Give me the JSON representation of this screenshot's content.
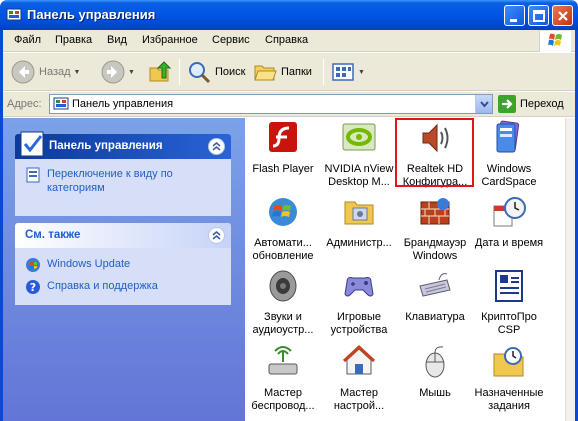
{
  "window": {
    "title": "Панель управления"
  },
  "menu": [
    "Файл",
    "Правка",
    "Вид",
    "Избранное",
    "Сервис",
    "Справка"
  ],
  "toolbar": {
    "back": "Назад",
    "search": "Поиск",
    "folders": "Папки"
  },
  "address": {
    "label": "Адрес:",
    "value": "Панель управления",
    "go": "Переход"
  },
  "left": {
    "panel1": {
      "title": "Панель управления",
      "link": [
        "Переключение к виду по",
        "категориям"
      ]
    },
    "panel2": {
      "title": "См. также",
      "links": [
        "Windows Update",
        "Справка и поддержка"
      ]
    }
  },
  "items": [
    {
      "l1": "Flash Player",
      "l2": "",
      "icon": "flash-player-icon"
    },
    {
      "l1": "NVIDIA nView",
      "l2": "Desktop M...",
      "icon": "nvidia-icon"
    },
    {
      "l1": "Realtek HD",
      "l2": "Конфигура...",
      "icon": "speaker-icon"
    },
    {
      "l1": "Windows",
      "l2": "CardSpace",
      "icon": "cardspace-icon"
    },
    {
      "l1": "Автомати...",
      "l2": "обновление",
      "icon": "windows-update-icon"
    },
    {
      "l1": "Администр...",
      "l2": "",
      "icon": "admin-tools-icon"
    },
    {
      "l1": "Брандмауэр",
      "l2": "Windows",
      "icon": "firewall-icon"
    },
    {
      "l1": "Дата и время",
      "l2": "",
      "icon": "clock-icon"
    },
    {
      "l1": "Звуки и",
      "l2": "аудиоустр...",
      "icon": "sound-icon"
    },
    {
      "l1": "Игровые",
      "l2": "устройства",
      "icon": "gamepad-icon"
    },
    {
      "l1": "Клавиатура",
      "l2": "",
      "icon": "keyboard-icon"
    },
    {
      "l1": "КриптоПро",
      "l2": "CSP",
      "icon": "cryptopro-icon"
    },
    {
      "l1": "Мастер",
      "l2": "беспровод...",
      "icon": "wireless-icon"
    },
    {
      "l1": "Мастер",
      "l2": "настрой...",
      "icon": "network-setup-icon"
    },
    {
      "l1": "Мышь",
      "l2": "",
      "icon": "mouse-icon"
    },
    {
      "l1": "Назначенные",
      "l2": "задания",
      "icon": "scheduled-tasks-icon"
    }
  ],
  "colors": {
    "titlebar": "#0055e5",
    "highlight": "#e0161c",
    "link": "#215dc6"
  }
}
